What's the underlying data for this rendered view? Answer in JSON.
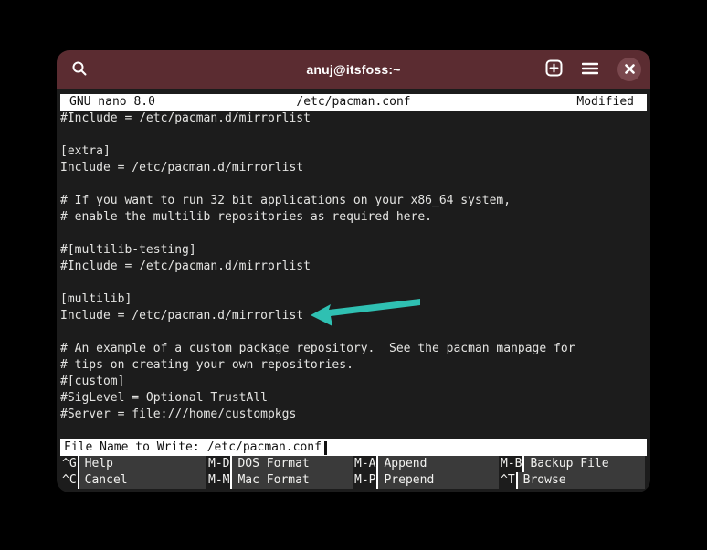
{
  "window": {
    "title": "anuj@itsfoss:~"
  },
  "nano": {
    "header": {
      "version": "GNU nano 8.0",
      "file": "/etc/pacman.conf",
      "status": "Modified"
    },
    "lines": [
      "#Include = /etc/pacman.d/mirrorlist",
      "",
      "[extra]",
      "Include = /etc/pacman.d/mirrorlist",
      "",
      "# If you want to run 32 bit applications on your x86_64 system,",
      "# enable the multilib repositories as required here.",
      "",
      "#[multilib-testing]",
      "#Include = /etc/pacman.d/mirrorlist",
      "",
      "[multilib]",
      "Include = /etc/pacman.d/mirrorlist",
      "",
      "# An example of a custom package repository.  See the pacman manpage for",
      "# tips on creating your own repositories.",
      "#[custom]",
      "#SigLevel = Optional TrustAll",
      "#Server = file:///home/custompkgs",
      ""
    ],
    "prompt": {
      "label": "File Name to Write:",
      "value": "/etc/pacman.conf"
    },
    "shortcuts_row1": [
      {
        "key": "^G",
        "label": "Help"
      },
      {
        "key": "M-D",
        "label": "DOS Format"
      },
      {
        "key": "M-A",
        "label": "Append"
      },
      {
        "key": "M-B",
        "label": "Backup File"
      }
    ],
    "shortcuts_row2": [
      {
        "key": "^C",
        "label": "Cancel"
      },
      {
        "key": "M-M",
        "label": "Mac Format"
      },
      {
        "key": "M-P",
        "label": "Prepend"
      },
      {
        "key": "^T",
        "label": "Browse"
      }
    ]
  },
  "annotation": {
    "type": "arrow",
    "points_at": "Include = /etc/pacman.d/mirrorlist",
    "color": "#2fc0b2"
  },
  "colors": {
    "page_background": "#000000",
    "titlebar": "#5b2c31",
    "close_button": "#7a484e",
    "terminal_background": "#1c1c1c",
    "terminal_text": "#e4e4e2",
    "nano_bar_background": "#ffffff",
    "nano_bar_text": "#111111",
    "shortcut_block": "#3a3a3a",
    "arrow": "#2fc0b2"
  }
}
